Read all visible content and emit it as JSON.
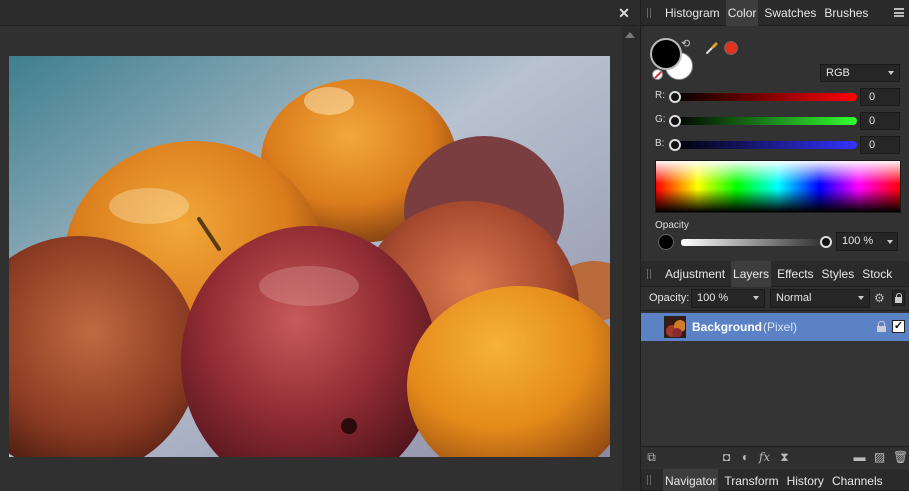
{
  "document": {
    "close_glyph": "✕"
  },
  "color_panel": {
    "tabs": [
      "Histogram",
      "Color",
      "Swatches",
      "Brushes"
    ],
    "active_tab": "Color",
    "color_model": "RGB",
    "channels": [
      {
        "label": "R:",
        "value": "0"
      },
      {
        "label": "G:",
        "value": "0"
      },
      {
        "label": "B:",
        "value": "0"
      }
    ],
    "opacity_label": "Opacity",
    "opacity_value": "100 %",
    "foreground_color": "#000000",
    "background_color": "#ffffff",
    "recent_color": "#e2321f"
  },
  "layers_panel": {
    "tabs": [
      "Adjustment",
      "Layers",
      "Effects",
      "Styles",
      "Stock"
    ],
    "active_tab": "Layers",
    "opacity_label": "Opacity:",
    "opacity_value": "100 %",
    "blend_mode": "Normal",
    "layers": [
      {
        "name": "Background",
        "type": "(Pixel)",
        "visible": true,
        "locked": true
      }
    ],
    "selection_color": "#5b82c4"
  },
  "navigator_panel": {
    "tabs": [
      "Navigator",
      "Transform",
      "History",
      "Channels"
    ],
    "active_tab": "Navigator"
  },
  "icons": {
    "swap": "swap-colors-icon",
    "picker": "color-picker-icon",
    "gear": "gear-icon",
    "lock": "lock-icon",
    "menu": "panel-menu-icon"
  }
}
